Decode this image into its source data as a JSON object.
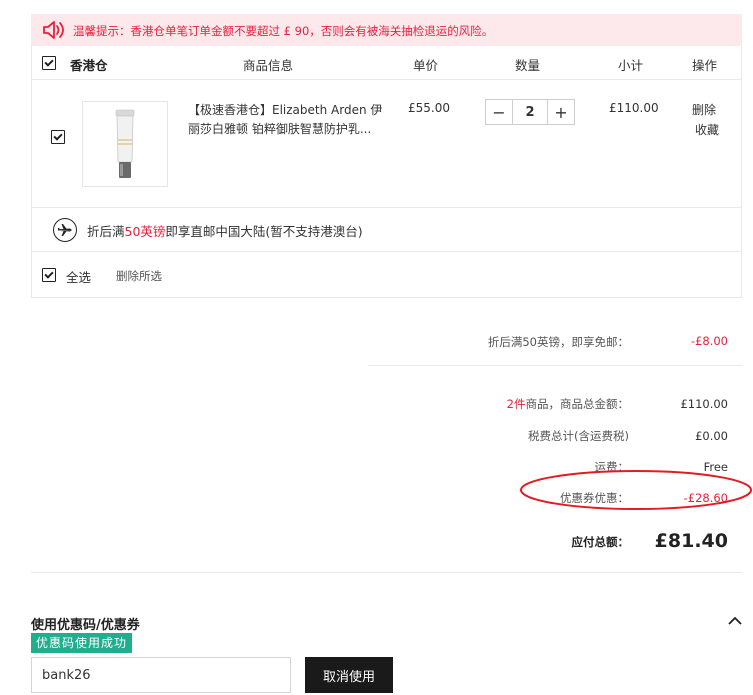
{
  "warning": {
    "text": "温馨提示：香港仓单笔订单金额不要超过 £ 90，否则会有被海关抽检退运的风险。",
    "icon": "speaker-icon",
    "color": "#e8213d"
  },
  "cart": {
    "warehouse": "香港仓",
    "columns": {
      "info": "商品信息",
      "price": "单价",
      "qty": "数量",
      "subtotal": "小计",
      "action": "操作"
    },
    "item": {
      "name": "【极速香港仓】Elizabeth Arden 伊丽莎白雅顿 铂粹御肤智慧防护乳...",
      "price": "£55.00",
      "qty": "2",
      "subtotal": "£110.00",
      "delete": "删除",
      "favorite": "收藏"
    },
    "shipping_prefix": "折后满",
    "shipping_highlight": "50英镑",
    "shipping_suffix": "即享直邮中国大陆(暂不支持港澳台)",
    "select_all": "全选",
    "delete_selected": "删除所选"
  },
  "summary": {
    "free_ship_label": "折后满50英镑，即享免邮：",
    "free_ship_value": "-£8.00",
    "count": "2件",
    "total_label": "商品，商品总金额：",
    "total_value": "£110.00",
    "tax_label": "税费总计(含运费税)",
    "tax_value": "£0.00",
    "shipping_label": "运费：",
    "shipping_value": "Free",
    "coupon_label": "优惠券优惠：",
    "coupon_value": "-£28.60",
    "payable_label": "应付总额：",
    "payable_value": "£81.40"
  },
  "coupon": {
    "title": "使用优惠码/优惠券",
    "success": "优惠码使用成功",
    "code": "bank26",
    "cancel": "取消使用"
  },
  "colors": {
    "accent_red": "#e8213d",
    "success_green": "#1fae8e",
    "button_dark": "#1a1a1a"
  }
}
